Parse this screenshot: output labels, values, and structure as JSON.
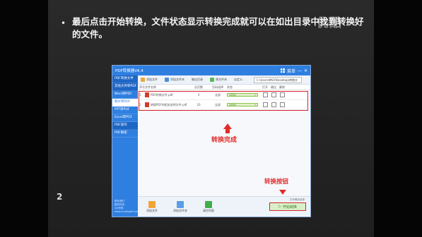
{
  "slide": {
    "caption": "最后点击开始转换，文件状态显示转换完成就可以在如出目录中找到转换好的文件。",
    "watermark": "优酷",
    "slide_number": "2"
  },
  "app": {
    "title": "PDF转换器V6.4",
    "window_controls": {
      "grid_label": "菜单",
      "minimize": "—",
      "close": "✕"
    },
    "toolbar": {
      "add_file": "添加文件",
      "add_folder": "添加文件夹",
      "output_dir_label": "输出目录",
      "original_dir": "原文件夹",
      "custom_dir": "自定义",
      "path": "C:\\Users\\MGY\\Desktop\\转换文"
    },
    "sidebar": {
      "items": [
        {
          "label": "PDF转换文件"
        },
        {
          "label": "其他文件转PDF"
        },
        {
          "label": "Word转PDF"
        },
        {
          "label": "图片转PDF"
        },
        {
          "label": "PPT转PDF"
        },
        {
          "label": "Excel转PDF"
        },
        {
          "label": "PDF操作"
        },
        {
          "label": "PDF解密"
        }
      ],
      "footer": [
        "联系我们",
        "服务热线",
        "QQ号码",
        "www.xunjiepdf.com"
      ]
    },
    "table": {
      "headers": [
        "序号",
        "文件名称",
        "总页数",
        "页码选择",
        "状态",
        "打开",
        "输出",
        "删除"
      ],
      "rows": [
        {
          "index": "1",
          "name": "PDF转换文件.pdf",
          "pages": "3",
          "range": "全部",
          "status": "100%"
        },
        {
          "index": "2",
          "name": "转换PDF的相关说明文件.pdf",
          "pages": "10",
          "range": "全部",
          "status": "100%"
        }
      ]
    },
    "bottom": {
      "add_file": "添加文件",
      "add_folder": "添加文件夹",
      "clear_list": "清空列表",
      "open_output": "打开输出目录",
      "start_label": "开始转换"
    }
  },
  "annotations": {
    "done": "转换完成",
    "start_button": "转换按钮"
  }
}
